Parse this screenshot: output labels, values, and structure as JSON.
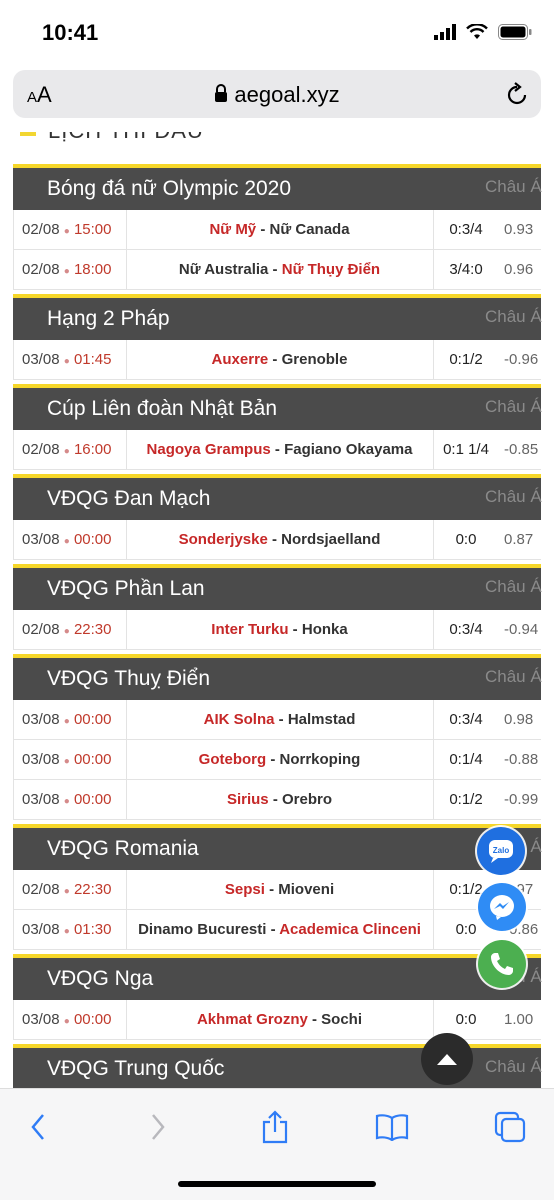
{
  "status": {
    "time": "10:41"
  },
  "browser": {
    "aa_small": "A",
    "aa_large": "A",
    "url": "aegoal.xyz"
  },
  "section_title": "LỊCH THI ĐẤU",
  "region_label": "Châu Á",
  "leagues": [
    {
      "name": "Bóng đá nữ Olympic 2020",
      "matches": [
        {
          "date": "02/08",
          "time": "15:00",
          "home": "Nữ Mỹ",
          "away": "Nữ Canada",
          "winner": "home",
          "handicap": "0:3/4",
          "odds": "0.93"
        },
        {
          "date": "02/08",
          "time": "18:00",
          "home": "Nữ Australia",
          "away": "Nữ Thụy Điển",
          "winner": "away",
          "handicap": "3/4:0",
          "odds": "0.96"
        }
      ]
    },
    {
      "name": "Hạng 2 Pháp",
      "matches": [
        {
          "date": "03/08",
          "time": "01:45",
          "home": "Auxerre",
          "away": "Grenoble",
          "winner": "home",
          "handicap": "0:1/2",
          "odds": "-0.96"
        }
      ]
    },
    {
      "name": "Cúp Liên đoàn Nhật Bản",
      "matches": [
        {
          "date": "02/08",
          "time": "16:00",
          "home": "Nagoya Grampus",
          "away": "Fagiano Okayama",
          "winner": "home",
          "handicap": "0:1 1/4",
          "odds": "-0.85"
        }
      ]
    },
    {
      "name": "VĐQG Đan Mạch",
      "matches": [
        {
          "date": "03/08",
          "time": "00:00",
          "home": "Sonderjyske",
          "away": "Nordsjaelland",
          "winner": "home",
          "handicap": "0:0",
          "odds": "0.87"
        }
      ]
    },
    {
      "name": "VĐQG Phần Lan",
      "matches": [
        {
          "date": "02/08",
          "time": "22:30",
          "home": "Inter Turku",
          "away": "Honka",
          "winner": "home",
          "handicap": "0:3/4",
          "odds": "-0.94"
        }
      ]
    },
    {
      "name": "VĐQG Thuỵ Điển",
      "matches": [
        {
          "date": "03/08",
          "time": "00:00",
          "home": "AIK Solna",
          "away": "Halmstad",
          "winner": "home",
          "handicap": "0:3/4",
          "odds": "0.98"
        },
        {
          "date": "03/08",
          "time": "00:00",
          "home": "Goteborg",
          "away": "Norrkoping",
          "winner": "home",
          "handicap": "0:1/4",
          "odds": "-0.88"
        },
        {
          "date": "03/08",
          "time": "00:00",
          "home": "Sirius",
          "away": "Orebro",
          "winner": "home",
          "handicap": "0:1/2",
          "odds": "-0.99"
        }
      ]
    },
    {
      "name": "VĐQG Romania",
      "matches": [
        {
          "date": "02/08",
          "time": "22:30",
          "home": "Sepsi",
          "away": "Mioveni",
          "winner": "home",
          "handicap": "0:1/2",
          "odds": "0.97"
        },
        {
          "date": "03/08",
          "time": "01:30",
          "home": "Dinamo Bucuresti",
          "away": "Academica Clinceni",
          "winner": "away",
          "handicap": "0:0",
          "odds": "-0.86"
        }
      ]
    },
    {
      "name": "VĐQG Nga",
      "matches": [
        {
          "date": "03/08",
          "time": "00:00",
          "home": "Akhmat Grozny",
          "away": "Sochi",
          "winner": "home",
          "handicap": "0:0",
          "odds": "1.00"
        }
      ]
    },
    {
      "name": "VĐQG Trung Quốc",
      "matches": []
    }
  ],
  "float_buttons": {
    "zalo_label": "Zalo"
  },
  "colors": {
    "header_bg": "#4b4b4b",
    "accent_yellow": "#f5d629",
    "team_red": "#c62828",
    "zalo": "#1f6fe0",
    "messenger": "#2f8cf5",
    "phone": "#4caf50"
  }
}
